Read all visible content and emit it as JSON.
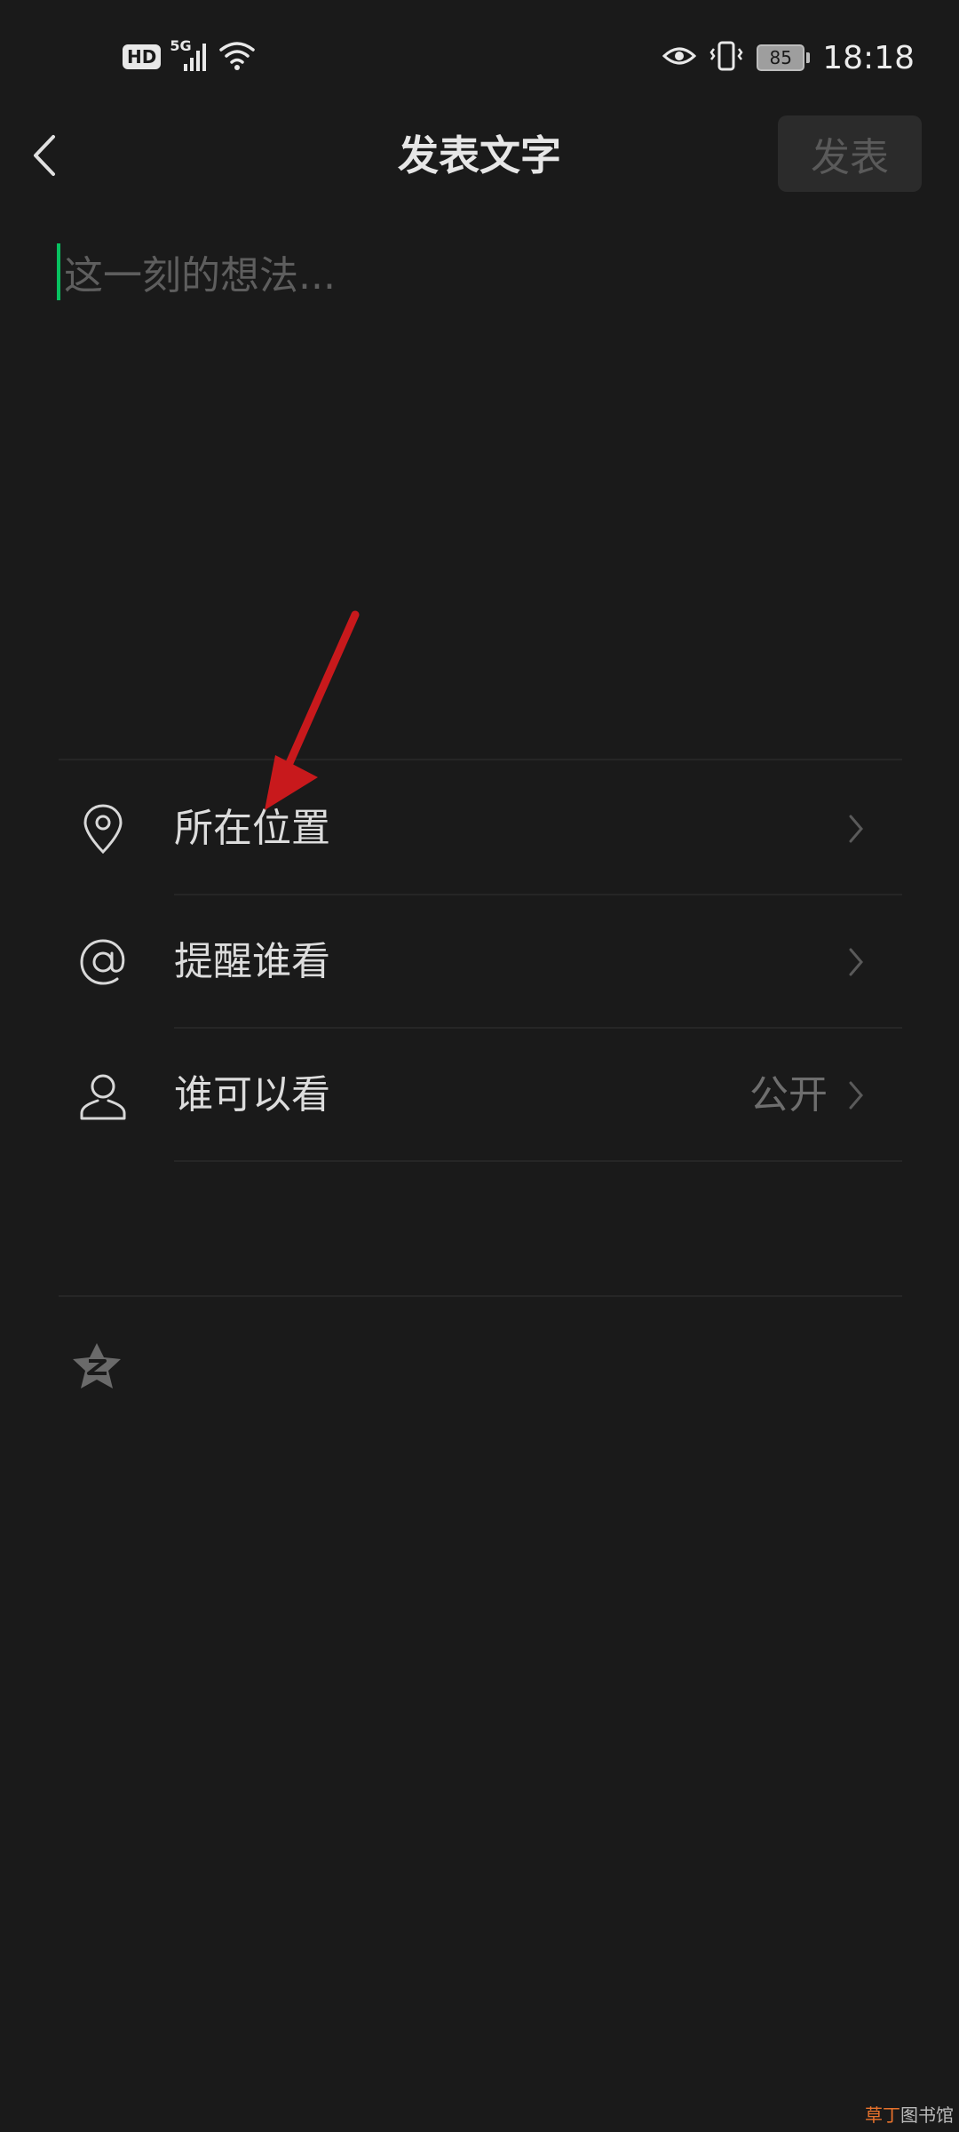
{
  "status_bar": {
    "hd": "HD",
    "network": "5G",
    "battery": "85",
    "time": "18:18"
  },
  "header": {
    "title": "发表文字",
    "publish_label": "发表"
  },
  "composer": {
    "placeholder": "这一刻的想法..."
  },
  "options": [
    {
      "label": "所在位置",
      "value": ""
    },
    {
      "label": "提醒谁看",
      "value": ""
    },
    {
      "label": "谁可以看",
      "value": "公开"
    }
  ],
  "watermark": {
    "accent": "草丁",
    "rest": "图书馆"
  },
  "colors": {
    "background": "#1a1a1a",
    "accent_cursor": "#07c160",
    "annotation_arrow": "#c8191c"
  }
}
